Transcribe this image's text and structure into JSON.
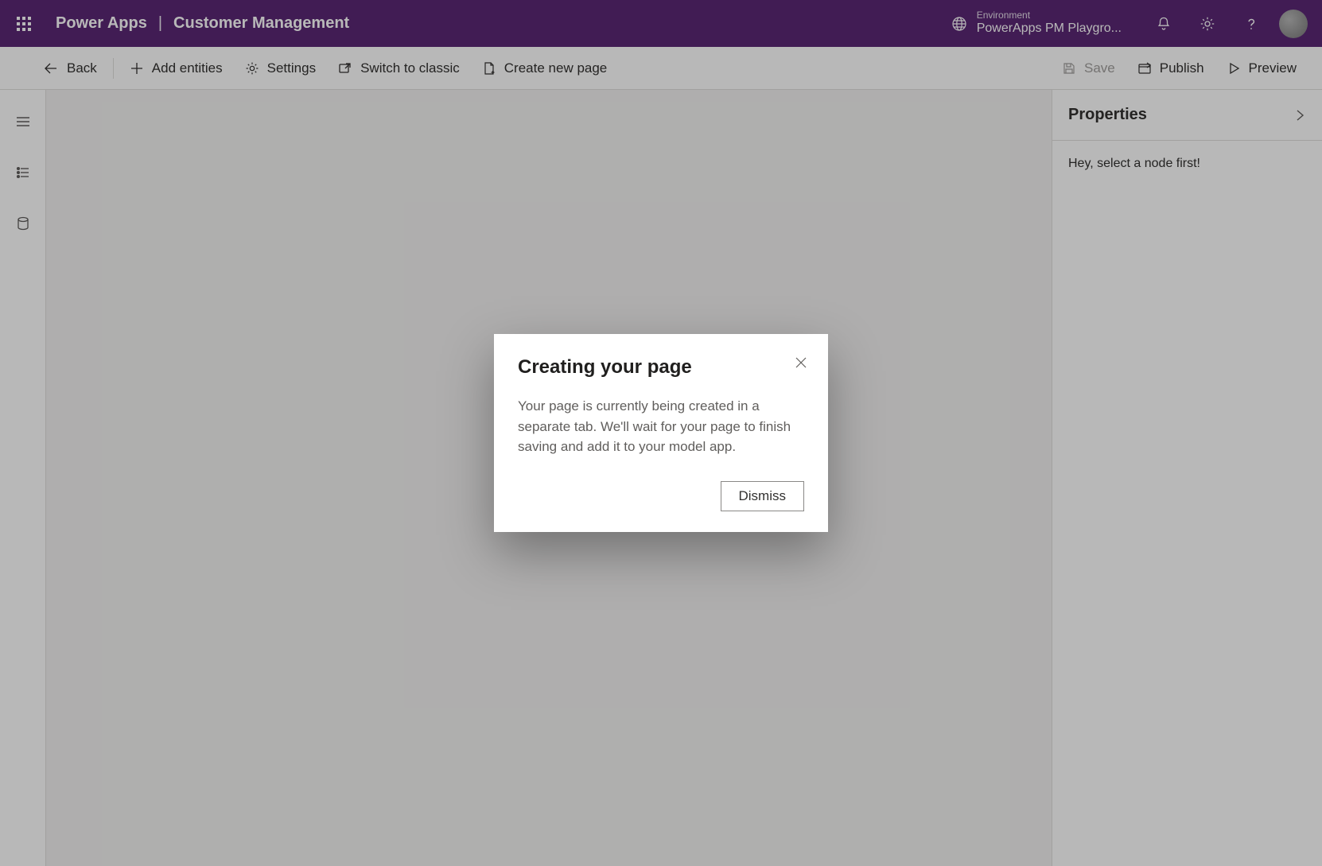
{
  "header": {
    "product": "Power Apps",
    "separator": "|",
    "appname": "Customer Management",
    "environment_label": "Environment",
    "environment_name": "PowerApps PM Playgro..."
  },
  "commandbar": {
    "back": "Back",
    "add_entities": "Add entities",
    "settings": "Settings",
    "switch_to_classic": "Switch to classic",
    "create_new_page": "Create new page",
    "save": "Save",
    "publish": "Publish",
    "preview": "Preview"
  },
  "properties": {
    "title": "Properties",
    "message": "Hey, select a node first!"
  },
  "modal": {
    "title": "Creating your page",
    "body": "Your page is currently being created in a separate tab. We'll wait for your page to finish saving and add it to your model app.",
    "dismiss": "Dismiss"
  }
}
